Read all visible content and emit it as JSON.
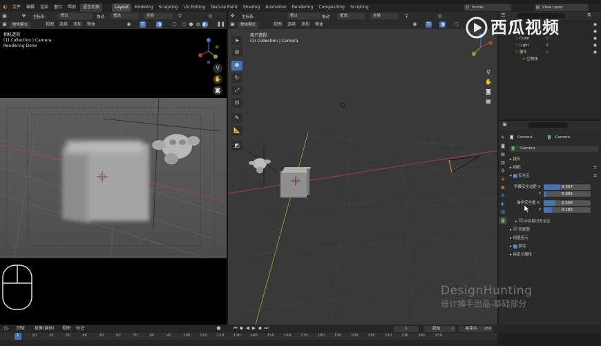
{
  "topbar": {
    "menus": [
      "文件",
      "编辑",
      "渲染",
      "窗口",
      "帮助"
    ],
    "workspace_switch": "语言切换",
    "tabs": [
      "Layout",
      "Modeling",
      "Sculpting",
      "UV Editing",
      "Texture Paint",
      "Shading",
      "Animation",
      "Rendering",
      "Compositing",
      "Scripting"
    ],
    "active_tab": "Layout",
    "scene_name": "Scene",
    "view_layer": "View Layer"
  },
  "header_tools": {
    "coord_label": "坐标系:",
    "coord_value": "默认",
    "drag_label": "拖动",
    "select_label": "框选",
    "pivot_label": "全局"
  },
  "left_viewport": {
    "mode": "物体模式",
    "menus": [
      "视图",
      "选择",
      "添加",
      "物体"
    ],
    "overlay_line1": "相机透视",
    "overlay_line2": "(1) Collection | Camera",
    "overlay_line3": "Rendering Done"
  },
  "main_viewport": {
    "mode": "物体模式",
    "menus": [
      "视图",
      "选择",
      "添加",
      "物体"
    ],
    "overlay_line1": "用户透视",
    "overlay_line2": "(1) Collection | Camera"
  },
  "outliner": {
    "items": [
      {
        "name": "Cube"
      },
      {
        "name": "Light"
      },
      {
        "name": "猴头"
      },
      {
        "name": "空物体"
      }
    ]
  },
  "properties": {
    "search_placeholder": "",
    "breadcrumb_object": "Camera",
    "breadcrumb_data": "Camera",
    "data_name": "Camera",
    "sections": {
      "lens": "镜头",
      "camera": "相机",
      "safe_areas": "安全区",
      "background_images": "背景图",
      "viewport_display": "视图显示",
      "dof": "景深",
      "custom_props": "自定义属性",
      "center_cut": "中间裁切安全区"
    },
    "title_safe_label": "字幕安全边距 X",
    "action_safe_label": "操作安全框 X",
    "y_label": "Y",
    "title_safe_x": "0.357",
    "title_safe_y": "0.065",
    "action_safe_x": "0.256",
    "action_safe_y": "0.182",
    "title_safe_x_frac": 0.357,
    "title_safe_y_frac": 0.065,
    "action_safe_x_frac": 0.256,
    "action_safe_y_frac": 0.182
  },
  "timeline": {
    "playback": "回放",
    "keying": "抠像(插帧)",
    "view": "视图",
    "marker": "标记",
    "current_frame": "1",
    "start_label": "起始",
    "start_value": "1",
    "end_label": "结束点",
    "end_value": "250",
    "ruler": [
      "1",
      "10",
      "20",
      "30",
      "40",
      "50",
      "60",
      "70",
      "80",
      "90",
      "100",
      "110",
      "120",
      "130",
      "140",
      "150",
      "160",
      "170",
      "180",
      "190",
      "200",
      "210",
      "220",
      "230",
      "240",
      "250"
    ]
  },
  "watermark": {
    "logo_text": "西瓜视频",
    "brand": "DesignHunting",
    "subtitle": "设计捕手出品-基础部分"
  },
  "colors": {
    "accent": "#4772b3",
    "x_axis": "#b83a3a",
    "y_axis": "#8aa234",
    "bg_panel": "#2b2b2b"
  }
}
